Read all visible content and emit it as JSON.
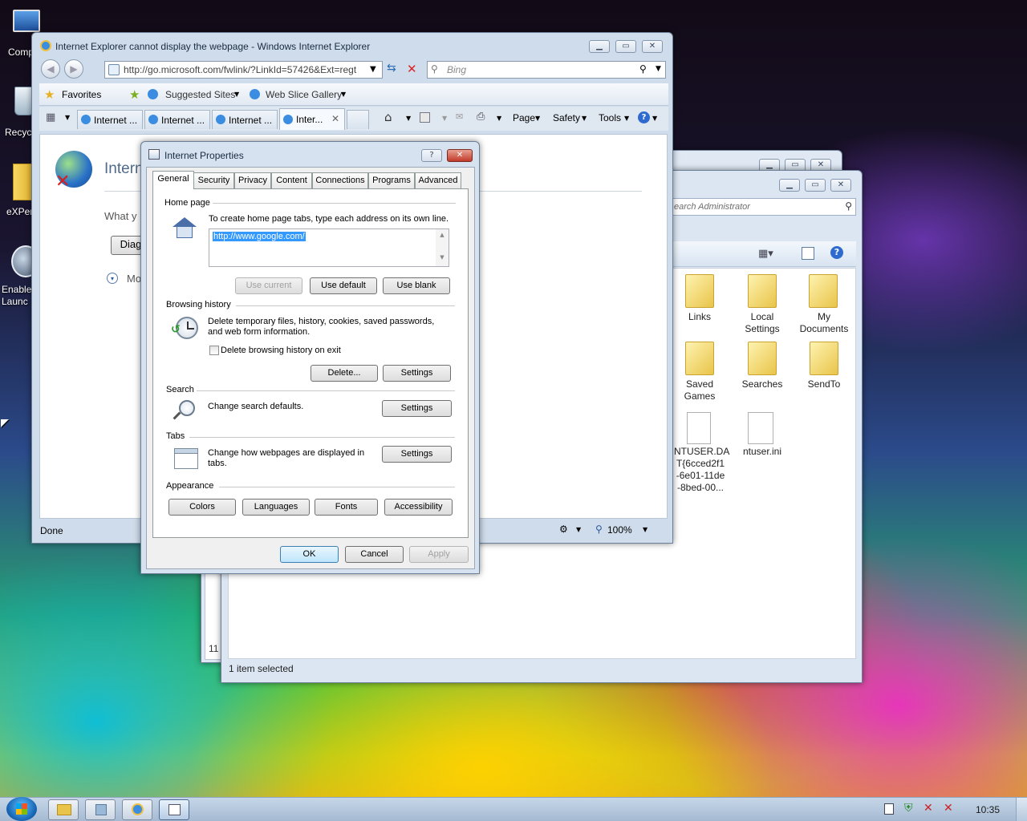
{
  "desktop": {
    "icons": [
      {
        "label": "Comp"
      },
      {
        "label": "Recyc"
      },
      {
        "label": "eXPer"
      },
      {
        "label": "Enable\nLaunc"
      }
    ]
  },
  "ie": {
    "title": "Internet Explorer cannot display the webpage - Windows Internet Explorer",
    "address": "http://go.microsoft.com/fwlink/?LinkId=57426&Ext=regt",
    "search_placeholder": "Bing",
    "favorites": "Favorites",
    "suggested": "Suggested Sites",
    "webslice": "Web Slice Gallery",
    "tabs": [
      "Internet ...",
      "Internet ...",
      "Internet ...",
      "Inter..."
    ],
    "cmd": {
      "page": "Page",
      "safety": "Safety",
      "tools": "Tools"
    },
    "content": {
      "heading": "Intern",
      "what": "What y",
      "diag": "Diag",
      "more": "Mo"
    },
    "status": "Done",
    "zoom": "100%"
  },
  "explorer": {
    "search_placeholder": "earch Administrator",
    "status": "1 item selected",
    "count": "11",
    "items": [
      {
        "label": "Links"
      },
      {
        "label": "Local\nSettings"
      },
      {
        "label": "My\nDocuments"
      },
      {
        "label": "Saved\nGames"
      },
      {
        "label": "Searches"
      },
      {
        "label": "SendTo"
      },
      {
        "label": "NTUSER.DA\nT{6cced2f1\n-6e01-11de\n-8bed-00..."
      },
      {
        "label": "ntuser.ini"
      }
    ]
  },
  "dialog": {
    "title": "Internet Properties",
    "tabs": [
      "General",
      "Security",
      "Privacy",
      "Content",
      "Connections",
      "Programs",
      "Advanced"
    ],
    "home": {
      "section": "Home page",
      "desc": "To create home page tabs, type each address on its own line.",
      "value": "http://www.google.com/",
      "use_current": "Use current",
      "use_default": "Use default",
      "use_blank": "Use blank"
    },
    "history": {
      "section": "Browsing history",
      "desc": "Delete temporary files, history, cookies, saved passwords,\nand web form information.",
      "checkbox": "Delete browsing history on exit",
      "delete": "Delete...",
      "settings": "Settings"
    },
    "search": {
      "section": "Search",
      "desc": "Change search defaults.",
      "settings": "Settings"
    },
    "tabs_sec": {
      "section": "Tabs",
      "desc": "Change how webpages are displayed in\ntabs.",
      "settings": "Settings"
    },
    "appearance": {
      "section": "Appearance",
      "colors": "Colors",
      "languages": "Languages",
      "fonts": "Fonts",
      "accessibility": "Accessibility"
    },
    "ok": "OK",
    "cancel": "Cancel",
    "apply": "Apply"
  },
  "taskbar": {
    "clock": "10:35"
  }
}
